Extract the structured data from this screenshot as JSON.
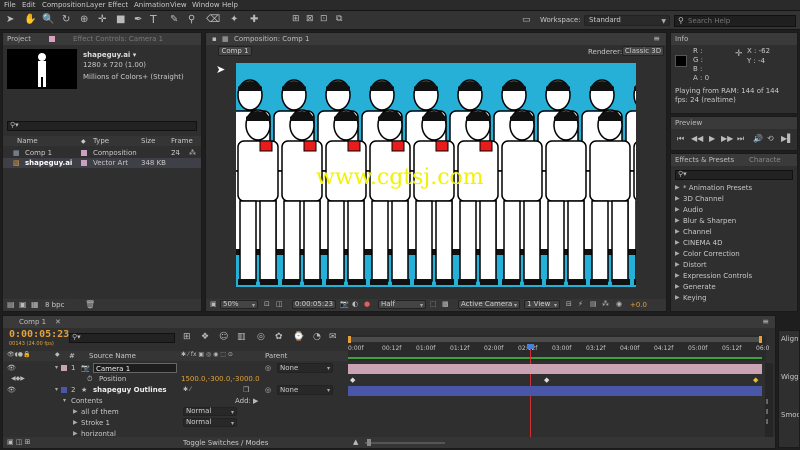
{
  "menu": [
    "File",
    "Edit",
    "Composition",
    "Layer",
    "Effect",
    "Animation",
    "View",
    "Window",
    "Help"
  ],
  "workspace": {
    "label": "Workspace:",
    "value": "Standard"
  },
  "search_help": {
    "placeholder": "Search Help"
  },
  "project_panel": {
    "tab_project": "Project",
    "tab_effect_controls": "Effect Controls: Camera 1",
    "selected_name": "shapeguy.ai ▾",
    "selected_size": "1280 x 720 (1.00)",
    "selected_colors": "Millions of Colors+ (Straight)",
    "columns": {
      "name": "Name",
      "type": "Type",
      "size": "Size",
      "frame": "Frame ..."
    },
    "items": [
      {
        "name": "Comp 1",
        "type": "Composition",
        "size": "",
        "frame": "24"
      },
      {
        "name": "shapeguy.ai",
        "type": "Vector Art",
        "size": "348 KB",
        "frame": ""
      }
    ],
    "bpc": "8 bpc"
  },
  "comp_panel": {
    "title": "Composition: Comp 1",
    "tab": "Comp 1",
    "renderer_label": "Renderer:",
    "renderer_value": "Classic 3D",
    "watermark": "www.cgtsj.com",
    "zoom": "50%",
    "timecode": "0:00:05:23",
    "resolution": "Half",
    "camera": "Active Camera",
    "view": "1 View",
    "exposure": "+0.0"
  },
  "info_panel": {
    "title": "Info",
    "r": "R :",
    "g": "G :",
    "b": "B :",
    "a": "A :  0",
    "x": "X : -62",
    "y": "Y : -4",
    "ram_text": "Playing from RAM: 144 of 144",
    "fps_text": "fps: 24 (realtime)"
  },
  "preview_panel": {
    "title": "Preview"
  },
  "effects_panel": {
    "tab_effects": "Effects & Presets",
    "tab_characters": "Characte",
    "items": [
      "* Animation Presets",
      "3D Channel",
      "Audio",
      "Blur & Sharpen",
      "Channel",
      "CINEMA 4D",
      "Color Correction",
      "Distort",
      "Expression Controls",
      "Generate",
      "Keying"
    ]
  },
  "timeline": {
    "tab": "Comp 1",
    "timecode": "0:00:05:23",
    "fps_sub": "00143 (24.00 fps)",
    "col_source": "Source Name",
    "col_parent": "Parent",
    "ruler": [
      "0:00f",
      "00:12f",
      "01:00f",
      "01:12f",
      "02:00f",
      "02:12f",
      "03:00f",
      "03:12f",
      "04:00f",
      "04:12f",
      "05:00f",
      "05:12f",
      "06:0"
    ],
    "layers": [
      {
        "num": "1",
        "name": "Camera 1",
        "parent": "None"
      },
      {
        "num": "2",
        "name": "shapeguy Outlines",
        "parent": "None"
      }
    ],
    "position_label": "Position",
    "position_value": "1500.0,-300.0,-3000.0",
    "contents_label": "Contents",
    "add_label": "Add:",
    "sub_items": [
      {
        "name": "all of them",
        "mode": "Normal"
      },
      {
        "name": "Stroke 1",
        "mode": "Normal"
      },
      {
        "name": "horizontal",
        "mode": ""
      }
    ],
    "toggle_label": "Toggle Switches / Modes"
  },
  "right_edge": {
    "align": "Align",
    "wiggle": "Wiggl",
    "smoother": "Smoo"
  },
  "colors": {
    "accent_timecode": "#e2a13a",
    "comp_bg": "#27b0d7",
    "watermark": "#f2f200",
    "layer_pink": "#c9a3b2",
    "layer_blue": "#4a56a8",
    "playhead": "#d23030"
  }
}
